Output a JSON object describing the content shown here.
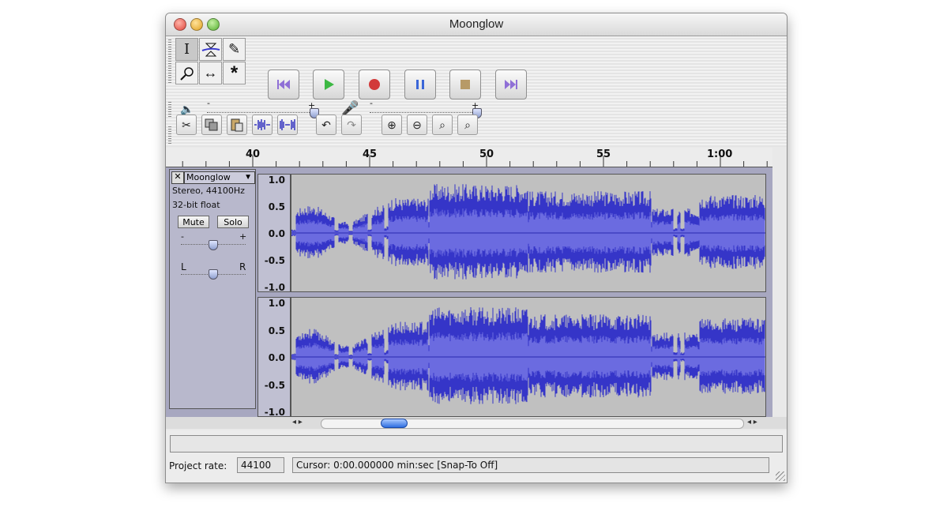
{
  "window": {
    "title": "Moonglow"
  },
  "transport": {
    "buttons": [
      {
        "name": "skip-to-start",
        "color": "#8f6fd6"
      },
      {
        "name": "play",
        "color": "#3cb843"
      },
      {
        "name": "record",
        "color": "#d23a3a"
      },
      {
        "name": "pause",
        "color": "#3a66d8"
      },
      {
        "name": "stop",
        "color": "#b79a67"
      },
      {
        "name": "skip-to-end",
        "color": "#8f6fd6"
      }
    ]
  },
  "mixer": {
    "minus": "-",
    "plus": "+",
    "output_level": 1.0,
    "input_level": 1.0
  },
  "ruler": {
    "labels": [
      "40",
      "45",
      "50",
      "55",
      "1:00"
    ]
  },
  "track": {
    "name": "Moonglow",
    "format": "Stereo, 44100Hz",
    "sample_format": "32-bit float",
    "mute_label": "Mute",
    "solo_label": "Solo",
    "gain_minus": "-",
    "gain_plus": "+",
    "pan_left": "L",
    "pan_right": "R",
    "gain_level": 0.5,
    "pan_level": 0.5,
    "vruler_labels": [
      "1.0",
      "0.5",
      "0.0",
      "-0.5",
      "-1.0"
    ],
    "wave_color": "#3535c8",
    "wave_rms_color": "#6b6be0",
    "wave_background": "#c0c0c0"
  },
  "status": {
    "project_rate_label": "Project rate:",
    "project_rate_value": "44100",
    "cursor_text": "Cursor: 0:00.000000 min:sec  [Snap-To Off]"
  }
}
